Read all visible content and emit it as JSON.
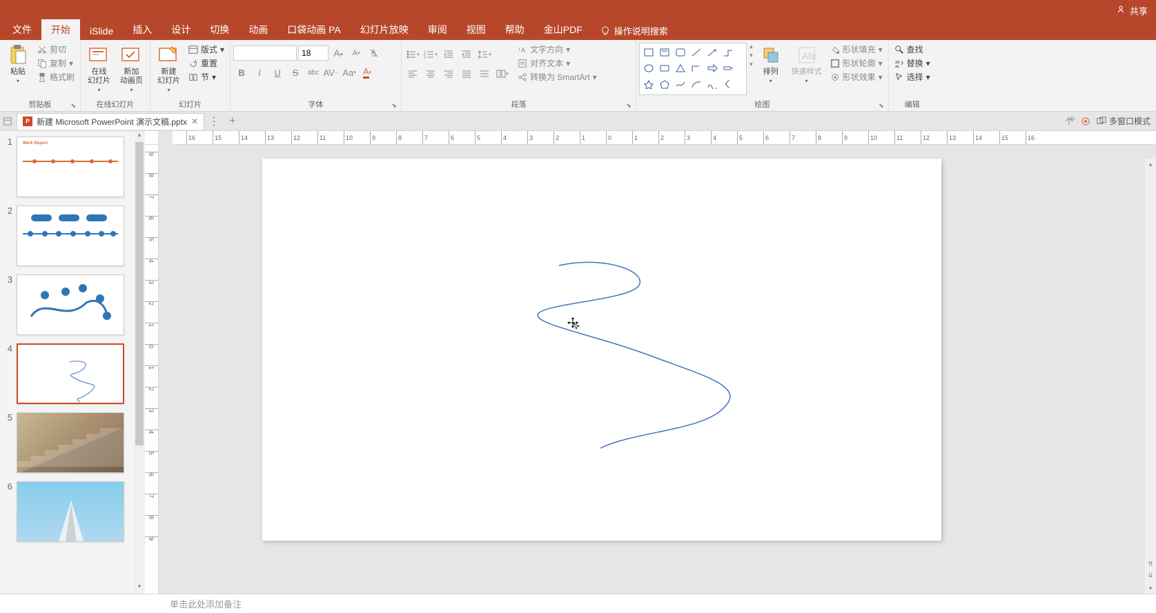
{
  "titlebar": {
    "share": "共享"
  },
  "menu": {
    "tabs": [
      "文件",
      "开始",
      "iSlide",
      "插入",
      "设计",
      "切换",
      "动画",
      "口袋动画 PA",
      "幻灯片放映",
      "审阅",
      "视图",
      "帮助",
      "金山PDF"
    ],
    "active_index": 1,
    "tell_me": "操作说明搜索"
  },
  "ribbon": {
    "clipboard": {
      "label": "剪贴板",
      "paste": "粘贴",
      "cut": "剪切",
      "copy": "复制",
      "format_painter": "格式刷"
    },
    "online_slides": {
      "label": "在线幻灯片",
      "online": "在线\n幻灯片",
      "add_animation": "新加\n动画页"
    },
    "slides": {
      "label": "幻灯片",
      "new_slide": "新建\n幻灯片",
      "layout": "版式",
      "reset": "重置",
      "section": "节"
    },
    "font": {
      "label": "字体",
      "size": "18"
    },
    "paragraph": {
      "label": "段落",
      "text_direction": "文字方向",
      "align_text": "对齐文本",
      "convert_smartart": "转换为 SmartArt"
    },
    "drawing": {
      "label": "绘图",
      "arrange": "排列",
      "quick_styles": "快速样式",
      "shape_fill": "形状填充",
      "shape_outline": "形状轮廓",
      "shape_effects": "形状效果"
    },
    "editing": {
      "label": "编辑",
      "find": "查找",
      "replace": "替换",
      "select": "选择"
    }
  },
  "doctab": {
    "filename": "新建 Microsoft PowerPoint 演示文稿.pptx",
    "multi_window": "多窗口模式"
  },
  "slides": [
    {
      "num": "1"
    },
    {
      "num": "2"
    },
    {
      "num": "3"
    },
    {
      "num": "4"
    },
    {
      "num": "5"
    },
    {
      "num": "6"
    }
  ],
  "selected_slide": 4,
  "notes": {
    "placeholder": "单击此处添加备注"
  },
  "ruler_h": [
    "16",
    "15",
    "14",
    "13",
    "12",
    "11",
    "10",
    "9",
    "8",
    "7",
    "6",
    "5",
    "4",
    "3",
    "2",
    "1",
    "0",
    "1",
    "2",
    "3",
    "4",
    "5",
    "6",
    "7",
    "8",
    "9",
    "10",
    "11",
    "12",
    "13",
    "14",
    "15",
    "16"
  ],
  "ruler_v": [
    "9",
    "8",
    "7",
    "6",
    "5",
    "4",
    "3",
    "2",
    "1",
    "0",
    "1",
    "2",
    "3",
    "4",
    "5",
    "6",
    "7",
    "8",
    "9"
  ]
}
